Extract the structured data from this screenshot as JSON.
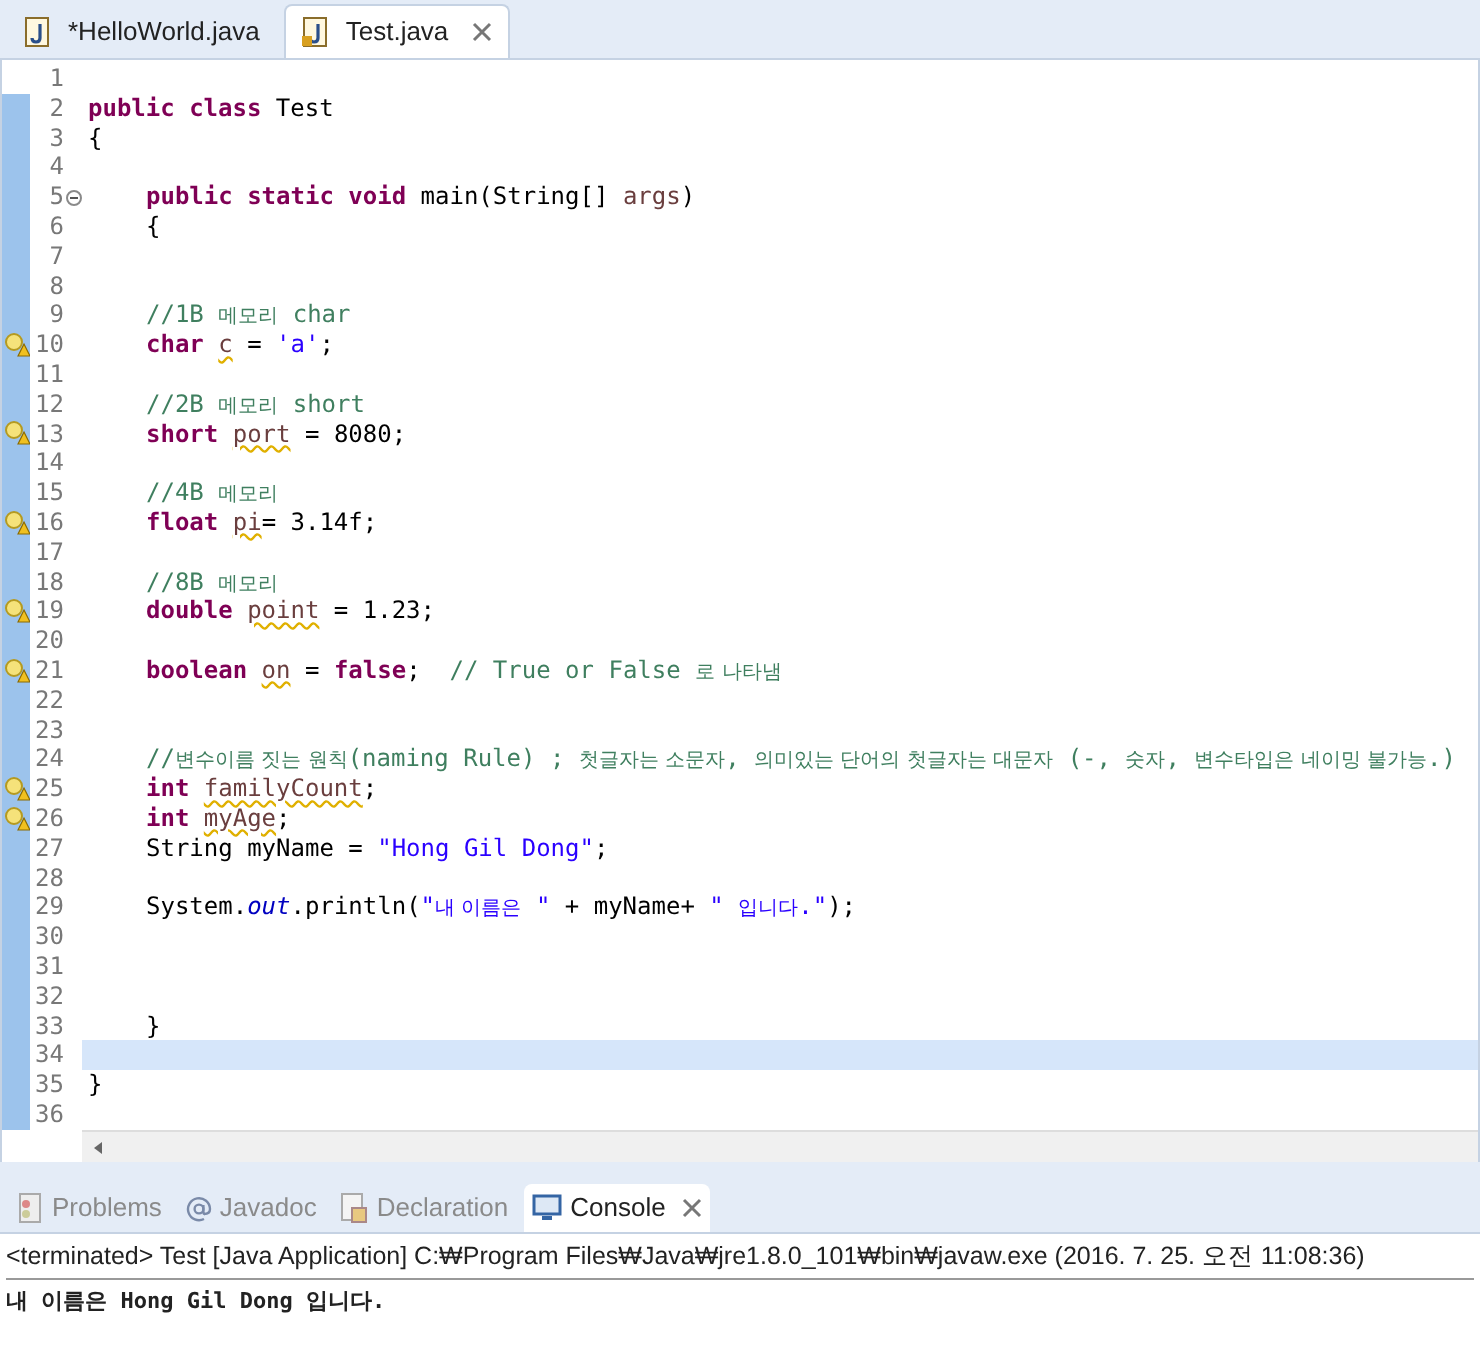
{
  "editor_tabs": [
    {
      "label": "*HelloWorld.java",
      "selected": false
    },
    {
      "label": "Test.java",
      "selected": true
    }
  ],
  "code_lines": [
    {
      "number": "1",
      "warning": false,
      "fold": false,
      "current": false
    },
    {
      "number": "2",
      "warning": false,
      "fold": false,
      "current": false,
      "indented": false,
      "tokens": [
        {
          "kind": "keyword",
          "text": "public class "
        },
        {
          "kind": "plain",
          "text": "Test"
        }
      ]
    },
    {
      "number": "3",
      "warning": false,
      "fold": false,
      "current": false,
      "indented": false,
      "tokens": [
        {
          "kind": "plain",
          "text": "{"
        }
      ]
    },
    {
      "number": "4",
      "warning": false,
      "fold": false,
      "current": false
    },
    {
      "number": "5",
      "warning": false,
      "fold": true,
      "current": false,
      "indented": true,
      "tokens": [
        {
          "kind": "keyword",
          "text": "public static void "
        },
        {
          "kind": "plain",
          "text": "main(String[] "
        },
        {
          "kind": "param",
          "text": "args"
        },
        {
          "kind": "plain",
          "text": ")"
        }
      ]
    },
    {
      "number": "6",
      "warning": false,
      "fold": false,
      "current": false,
      "indented": true,
      "tokens": [
        {
          "kind": "plain",
          "text": "{"
        }
      ]
    },
    {
      "number": "7",
      "warning": false,
      "fold": false,
      "current": false
    },
    {
      "number": "8",
      "warning": false,
      "fold": false,
      "current": false
    },
    {
      "number": "9",
      "warning": false,
      "fold": false,
      "current": false,
      "indented": true,
      "tokens": [
        {
          "kind": "comment",
          "text": "//1B "
        },
        {
          "kind": "comment_ko",
          "text": "메모리"
        },
        {
          "kind": "comment",
          "text": " char"
        }
      ]
    },
    {
      "number": "10",
      "warning": true,
      "fold": false,
      "current": false,
      "indented": true,
      "tokens": [
        {
          "kind": "keyword",
          "text": "char "
        },
        {
          "kind": "warned",
          "text": "c"
        },
        {
          "kind": "plain",
          "text": " = "
        },
        {
          "kind": "string",
          "text": "'a'"
        },
        {
          "kind": "plain",
          "text": ";"
        }
      ]
    },
    {
      "number": "11",
      "warning": false,
      "fold": false,
      "current": false
    },
    {
      "number": "12",
      "warning": false,
      "fold": false,
      "current": false,
      "indented": true,
      "tokens": [
        {
          "kind": "comment",
          "text": "//2B "
        },
        {
          "kind": "comment_ko",
          "text": "메모리"
        },
        {
          "kind": "comment",
          "text": " short"
        }
      ]
    },
    {
      "number": "13",
      "warning": true,
      "fold": false,
      "current": false,
      "indented": true,
      "tokens": [
        {
          "kind": "keyword",
          "text": "short "
        },
        {
          "kind": "warned",
          "text": "port"
        },
        {
          "kind": "plain",
          "text": " = 8080;"
        }
      ]
    },
    {
      "number": "14",
      "warning": false,
      "fold": false,
      "current": false
    },
    {
      "number": "15",
      "warning": false,
      "fold": false,
      "current": false,
      "indented": true,
      "tokens": [
        {
          "kind": "comment",
          "text": "//4B "
        },
        {
          "kind": "comment_ko",
          "text": "메모리"
        }
      ]
    },
    {
      "number": "16",
      "warning": true,
      "fold": false,
      "current": false,
      "indented": true,
      "tokens": [
        {
          "kind": "keyword",
          "text": "float "
        },
        {
          "kind": "warned",
          "text": "pi"
        },
        {
          "kind": "plain",
          "text": "= 3.14f;"
        }
      ]
    },
    {
      "number": "17",
      "warning": false,
      "fold": false,
      "current": false
    },
    {
      "number": "18",
      "warning": false,
      "fold": false,
      "current": false,
      "indented": true,
      "tokens": [
        {
          "kind": "comment",
          "text": "//8B "
        },
        {
          "kind": "comment_ko",
          "text": "메모리"
        }
      ]
    },
    {
      "number": "19",
      "warning": true,
      "fold": false,
      "current": false,
      "indented": true,
      "tokens": [
        {
          "kind": "keyword",
          "text": "double "
        },
        {
          "kind": "warned",
          "text": "point"
        },
        {
          "kind": "plain",
          "text": " = 1.23;"
        }
      ]
    },
    {
      "number": "20",
      "warning": false,
      "fold": false,
      "current": false
    },
    {
      "number": "21",
      "warning": true,
      "fold": false,
      "current": false,
      "indented": true,
      "tokens": [
        {
          "kind": "keyword",
          "text": "boolean "
        },
        {
          "kind": "warned",
          "text": "on"
        },
        {
          "kind": "plain",
          "text": " = "
        },
        {
          "kind": "keyword",
          "text": "false"
        },
        {
          "kind": "plain",
          "text": ";  "
        },
        {
          "kind": "comment",
          "text": "// True or False "
        },
        {
          "kind": "comment_ko",
          "text": "로 나타냄"
        }
      ]
    },
    {
      "number": "22",
      "warning": false,
      "fold": false,
      "current": false
    },
    {
      "number": "23",
      "warning": false,
      "fold": false,
      "current": false
    },
    {
      "number": "24",
      "warning": false,
      "fold": false,
      "current": false,
      "indented": true,
      "tokens": [
        {
          "kind": "comment",
          "text": "//"
        },
        {
          "kind": "comment_ko",
          "text": "변수이름 짓는 원칙"
        },
        {
          "kind": "comment",
          "text": "(naming Rule) ; "
        },
        {
          "kind": "comment_ko",
          "text": "첫글자는 소문자"
        },
        {
          "kind": "comment",
          "text": ", "
        },
        {
          "kind": "comment_ko",
          "text": "의미있는 단어의 첫글자는 대문자"
        },
        {
          "kind": "comment",
          "text": " (-, "
        },
        {
          "kind": "comment_ko",
          "text": "숫자"
        },
        {
          "kind": "comment",
          "text": ", "
        },
        {
          "kind": "comment_ko",
          "text": "변수타입은 네이밍 불가능"
        },
        {
          "kind": "comment",
          "text": ".)"
        }
      ]
    },
    {
      "number": "25",
      "warning": true,
      "fold": false,
      "current": false,
      "indented": true,
      "tokens": [
        {
          "kind": "keyword",
          "text": "int "
        },
        {
          "kind": "warned",
          "text": "familyCount"
        },
        {
          "kind": "plain",
          "text": ";"
        }
      ]
    },
    {
      "number": "26",
      "warning": true,
      "fold": false,
      "current": false,
      "indented": true,
      "tokens": [
        {
          "kind": "keyword",
          "text": "int "
        },
        {
          "kind": "warned",
          "text": "myAge"
        },
        {
          "kind": "plain",
          "text": ";"
        }
      ]
    },
    {
      "number": "27",
      "warning": false,
      "fold": false,
      "current": false,
      "indented": true,
      "tokens": [
        {
          "kind": "plain",
          "text": "String myName = "
        },
        {
          "kind": "string",
          "text": "\"Hong Gil Dong\""
        },
        {
          "kind": "plain",
          "text": ";"
        }
      ]
    },
    {
      "number": "28",
      "warning": false,
      "fold": false,
      "current": false
    },
    {
      "number": "29",
      "warning": false,
      "fold": false,
      "current": false,
      "indented": true,
      "tokens": [
        {
          "kind": "plain",
          "text": "System."
        },
        {
          "kind": "field",
          "text": "out"
        },
        {
          "kind": "plain",
          "text": ".println("
        },
        {
          "kind": "string",
          "text": "\""
        },
        {
          "kind": "string_ko",
          "text": "내 이름은"
        },
        {
          "kind": "string",
          "text": " \""
        },
        {
          "kind": "plain",
          "text": " + myName+ "
        },
        {
          "kind": "string",
          "text": "\" "
        },
        {
          "kind": "string_ko",
          "text": "입니다"
        },
        {
          "kind": "string",
          "text": ".\""
        },
        {
          "kind": "plain",
          "text": ");"
        }
      ]
    },
    {
      "number": "30",
      "warning": false,
      "fold": false,
      "current": false
    },
    {
      "number": "31",
      "warning": false,
      "fold": false,
      "current": false
    },
    {
      "number": "32",
      "warning": false,
      "fold": false,
      "current": false
    },
    {
      "number": "33",
      "warning": false,
      "fold": false,
      "current": false,
      "indented": true,
      "tokens": [
        {
          "kind": "plain",
          "text": "}"
        }
      ]
    },
    {
      "number": "34",
      "warning": false,
      "fold": false,
      "current": true
    },
    {
      "number": "35",
      "warning": false,
      "fold": false,
      "current": false,
      "indented": false,
      "tokens": [
        {
          "kind": "plain",
          "text": "}"
        }
      ]
    },
    {
      "number": "36",
      "warning": false,
      "fold": false,
      "current": false
    }
  ],
  "panel_tabs": [
    {
      "label": "Problems",
      "selected": false,
      "kind": "problems"
    },
    {
      "label": "Javadoc",
      "selected": false,
      "kind": "javadoc"
    },
    {
      "label": "Declaration",
      "selected": false,
      "kind": "declaration"
    },
    {
      "label": "Console",
      "selected": true,
      "kind": "console"
    }
  ],
  "console": {
    "header": "<terminated> Test [Java Application] C:₩Program Files₩Java₩jre1.8.0_101₩bin₩javaw.exe (2016. 7. 25. 오전 11:08:36)",
    "output": "내 이름은 Hong Gil Dong 입니다."
  }
}
